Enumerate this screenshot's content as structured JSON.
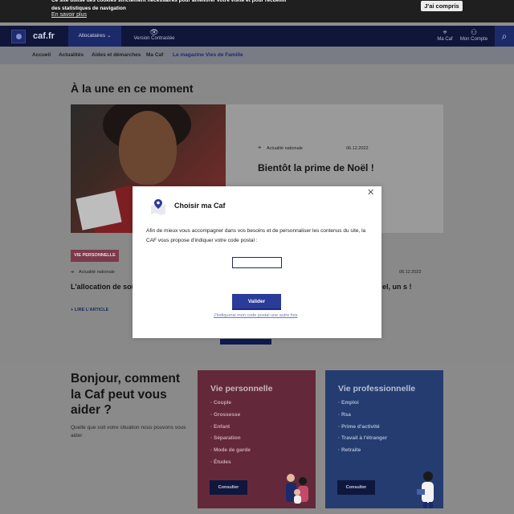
{
  "cookie": {
    "text": "Ce site utilise des cookies strictement nécessaires pour améliorer votre visite et pour recueillir des statistiques de navigation",
    "more_link": "En savoir plus",
    "accept": "J'ai compris"
  },
  "header": {
    "logo_text": "caf.fr",
    "menu_label": "Allocataires",
    "contrast_label": "Version Contrastée",
    "macaf_label": "Ma Caf",
    "compte_label": "Mon Compte"
  },
  "subnav": {
    "items": [
      "Accueil",
      "Actualités",
      "Aides et démarches",
      "Ma Caf",
      "Le magazine Vies de Famille"
    ]
  },
  "main": {
    "section_title": "À la une en ce moment",
    "hero": {
      "tag": "Actualité nationale",
      "date": "06.12.2022",
      "title": "Bientôt la prime de Noël !"
    },
    "article": {
      "badge": "VIE PERSONNELLE",
      "tag": "Actualité nationale",
      "date": "06.12.2022",
      "title_left": "L'allocation de sou familial augmente",
      "title_right": "el, un s !",
      "read_more": "LIRE L'ARTICLE"
    }
  },
  "bottom": {
    "heading": "Bonjour, comment la Caf peut vous aider ?",
    "subtext": "Quelle que soit votre situation nous pouvons vous aider",
    "card_perso": {
      "title": "Vie personnelle",
      "items": [
        "Couple",
        "Grossesse",
        "Enfant",
        "Séparation",
        "Mode de garde",
        "Études"
      ],
      "button": "Consulter"
    },
    "card_pro": {
      "title": "Vie professionnelle",
      "items": [
        "Emploi",
        "Rsa",
        "Prime d'activité",
        "Travail à l'étranger",
        "Retraite"
      ],
      "button": "Consulter"
    }
  },
  "modal": {
    "title": "Choisir ma Caf",
    "text": "Afin de mieux vous accompagner dans vos besoins et de personnaliser les contenus du site, la CAF vous propose d'indiquer votre code postal :",
    "input_value": "",
    "submit": "Valider",
    "later": "J'indiquerai mon code postal une autre fois"
  }
}
